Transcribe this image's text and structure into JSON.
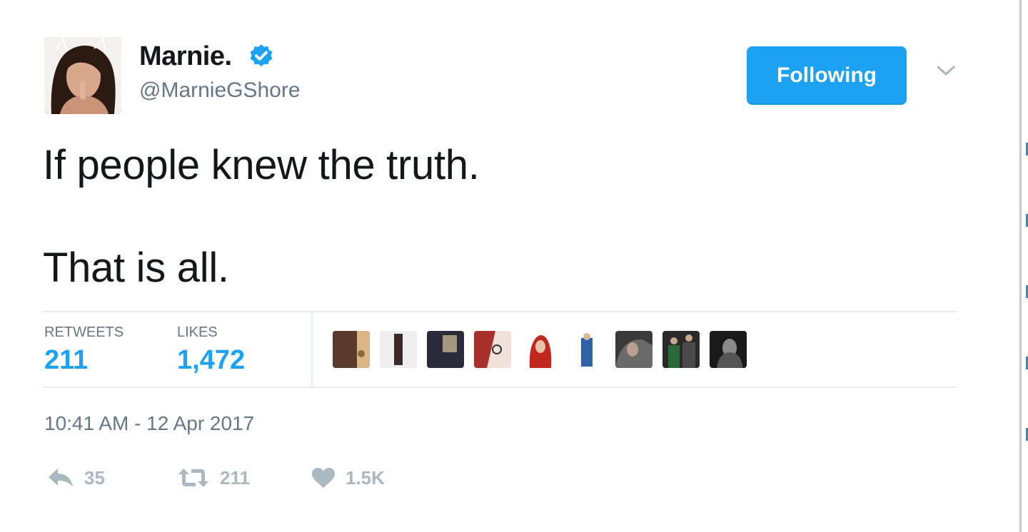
{
  "tweet": {
    "display_name": "Marnie.",
    "handle": "@MarnieGShore",
    "follow_label": "Following",
    "text_line1": "If people knew the truth.",
    "text_line2": "That is all.",
    "timestamp": "10:41 AM - 12 Apr 2017",
    "verified": true
  },
  "stats": {
    "retweets_label": "RETWEETS",
    "retweets_value": "211",
    "likes_label": "LIKES",
    "likes_value": "1,472"
  },
  "actions": {
    "reply_count": "35",
    "retweet_count": "211",
    "like_count": "1.5K"
  },
  "icons": {
    "verified": "verified-badge-icon",
    "chevron": "chevron-down-icon",
    "reply": "reply-icon",
    "retweet": "retweet-icon",
    "like": "heart-icon"
  },
  "colors": {
    "accent": "#1da1f2",
    "muted": "#657786",
    "action_gray": "#aab8c2",
    "text": "#14171a"
  }
}
